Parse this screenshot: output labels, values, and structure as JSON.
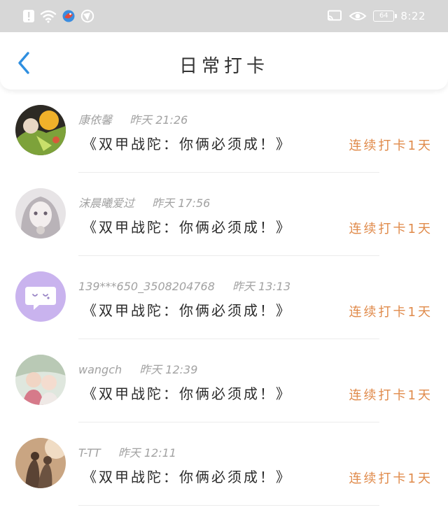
{
  "status_bar": {
    "battery": "64",
    "time": "8:22",
    "icons_left": [
      "alert-icon",
      "wifi-icon",
      "app-notification-icon",
      "vpn-icon"
    ],
    "icons_right": [
      "cast-icon",
      "eye-protection-icon",
      "battery-icon"
    ]
  },
  "header": {
    "title": "日常打卡",
    "back_icon": "chevron-left-icon"
  },
  "colors": {
    "accent": "#2f8fe0",
    "streak": "#e08a4a",
    "meta": "#a2a2a2",
    "status_bar_bg": "#d7d7d7"
  },
  "entries": [
    {
      "name": "康依馨",
      "time": "昨天  21:26",
      "message": "《双甲战陀：你俩必须成！》",
      "streak": "连续打卡1天"
    },
    {
      "name": "沫晨曦爱过",
      "time": "昨天  17:56",
      "message": "《双甲战陀：你俩必须成！》",
      "streak": "连续打卡1天"
    },
    {
      "name": "139***650_3508204768",
      "time": "昨天  13:13",
      "message": "《双甲战陀：你俩必须成！》",
      "streak": "连续打卡1天"
    },
    {
      "name": "wangch",
      "time": "昨天  12:39",
      "message": "《双甲战陀：你俩必须成！》",
      "streak": "连续打卡1天"
    },
    {
      "name": "T-TT",
      "time": "昨天  12:11",
      "message": "《双甲战陀：你俩必须成！》",
      "streak": "连续打卡1天"
    }
  ]
}
